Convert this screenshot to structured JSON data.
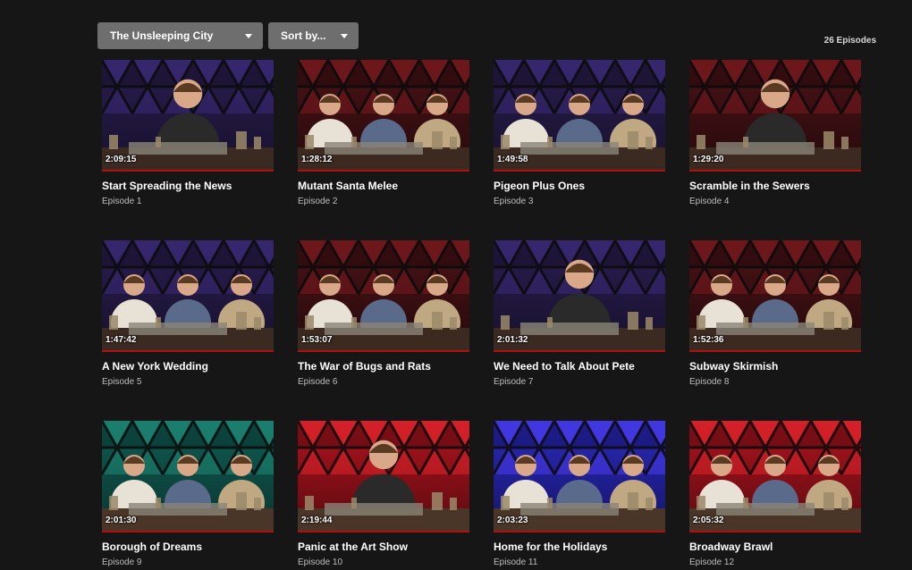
{
  "toolbar": {
    "series_select": "The Unsleeping City",
    "sort_select": "Sort by..."
  },
  "episode_count": "26 Episodes",
  "colors": {
    "progress_bar": "#b01010",
    "background": "#161616"
  },
  "episodes": [
    {
      "title": "Start Spreading the News",
      "episode": "Episode 1",
      "duration": "2:09:15",
      "theme": "purple",
      "people": 1
    },
    {
      "title": "Mutant Santa Melee",
      "episode": "Episode 2",
      "duration": "1:28:12",
      "theme": "red",
      "people": 3
    },
    {
      "title": "Pigeon Plus Ones",
      "episode": "Episode 3",
      "duration": "1:49:58",
      "theme": "purple",
      "people": 3
    },
    {
      "title": "Scramble in the Sewers",
      "episode": "Episode 4",
      "duration": "1:29:20",
      "theme": "red",
      "people": 1
    },
    {
      "title": "A New York Wedding",
      "episode": "Episode 5",
      "duration": "1:47:42",
      "theme": "purple",
      "people": 3
    },
    {
      "title": "The War of Bugs and Rats",
      "episode": "Episode 6",
      "duration": "1:53:07",
      "theme": "red",
      "people": 3
    },
    {
      "title": "We Need to Talk About Pete",
      "episode": "Episode 7",
      "duration": "2:01:32",
      "theme": "purple",
      "people": 1
    },
    {
      "title": "Subway Skirmish",
      "episode": "Episode 8",
      "duration": "1:52:36",
      "theme": "red",
      "people": 3
    },
    {
      "title": "Borough of Dreams",
      "episode": "Episode 9",
      "duration": "2:01:30",
      "theme": "teal",
      "people": 3
    },
    {
      "title": "Panic at the Art Show",
      "episode": "Episode 10",
      "duration": "2:19:44",
      "theme": "brightred",
      "people": 1
    },
    {
      "title": "Home for the Holidays",
      "episode": "Episode 11",
      "duration": "2:03:23",
      "theme": "blue",
      "people": 3
    },
    {
      "title": "Broadway Brawl",
      "episode": "Episode 12",
      "duration": "2:05:32",
      "theme": "brightred",
      "people": 3
    }
  ]
}
